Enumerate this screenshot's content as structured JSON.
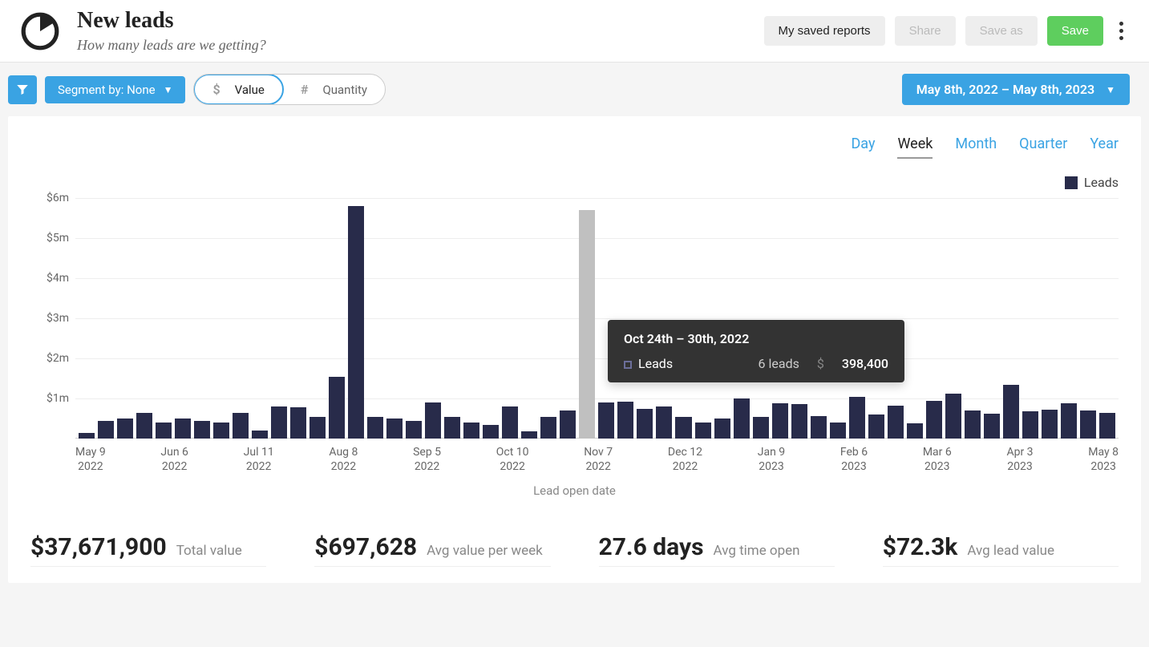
{
  "header": {
    "title": "New leads",
    "subtitle": "How many leads are we getting?",
    "buttons": {
      "saved_reports": "My saved reports",
      "share": "Share",
      "save_as": "Save as",
      "save": "Save"
    }
  },
  "filters": {
    "segment_label": "Segment by: None",
    "value_pill": {
      "symbol": "$",
      "label": "Value"
    },
    "quantity_pill": {
      "symbol": "#",
      "label": "Quantity"
    },
    "date_range": "May 8th, 2022 – May 8th, 2023"
  },
  "period_tabs": [
    "Day",
    "Week",
    "Month",
    "Quarter",
    "Year"
  ],
  "active_period": "Week",
  "legend_label": "Leads",
  "x_label": "Lead open date",
  "tooltip": {
    "title": "Oct 24th – 30th, 2022",
    "series": "Leads",
    "count": "6 leads",
    "currency": "$",
    "value": "398,400"
  },
  "stats": [
    {
      "value": "$37,671,900",
      "label": "Total value"
    },
    {
      "value": "$697,628",
      "label": "Avg value per week"
    },
    {
      "value": "27.6 days",
      "label": "Avg time open"
    },
    {
      "value": "$72.3k",
      "label": "Avg lead value"
    }
  ],
  "chart_data": {
    "type": "bar",
    "title": "New leads",
    "xlabel": "Lead open date",
    "ylabel": "",
    "ylim": [
      0,
      6000000
    ],
    "y_ticks": [
      "$1m",
      "$2m",
      "$3m",
      "$4m",
      "$5m",
      "$6m"
    ],
    "x_ticks": [
      {
        "l1": "May 9",
        "l2": "2022"
      },
      {
        "l1": "Jun 6",
        "l2": "2022"
      },
      {
        "l1": "Jul 11",
        "l2": "2022"
      },
      {
        "l1": "Aug 8",
        "l2": "2022"
      },
      {
        "l1": "Sep 5",
        "l2": "2022"
      },
      {
        "l1": "Oct 10",
        "l2": "2022"
      },
      {
        "l1": "Nov 7",
        "l2": "2022"
      },
      {
        "l1": "Dec 12",
        "l2": "2022"
      },
      {
        "l1": "Jan 9",
        "l2": "2023"
      },
      {
        "l1": "Feb 6",
        "l2": "2023"
      },
      {
        "l1": "Mar 6",
        "l2": "2023"
      },
      {
        "l1": "Apr 3",
        "l2": "2023"
      },
      {
        "l1": "May 8",
        "l2": "2023"
      }
    ],
    "series": [
      {
        "name": "Leads",
        "values": [
          150000,
          450000,
          500000,
          650000,
          400000,
          500000,
          450000,
          400000,
          650000,
          200000,
          800000,
          780000,
          550000,
          1550000,
          5800000,
          550000,
          500000,
          450000,
          900000,
          550000,
          400000,
          350000,
          800000,
          180000,
          550000,
          700000,
          398400,
          900000,
          920000,
          750000,
          800000,
          550000,
          400000,
          500000,
          1000000,
          550000,
          880000,
          870000,
          560000,
          400000,
          1050000,
          600000,
          820000,
          380000,
          950000,
          1130000,
          700000,
          620000,
          1350000,
          680000,
          720000,
          880000,
          710000,
          640000
        ]
      }
    ],
    "highlight_index": 26
  }
}
